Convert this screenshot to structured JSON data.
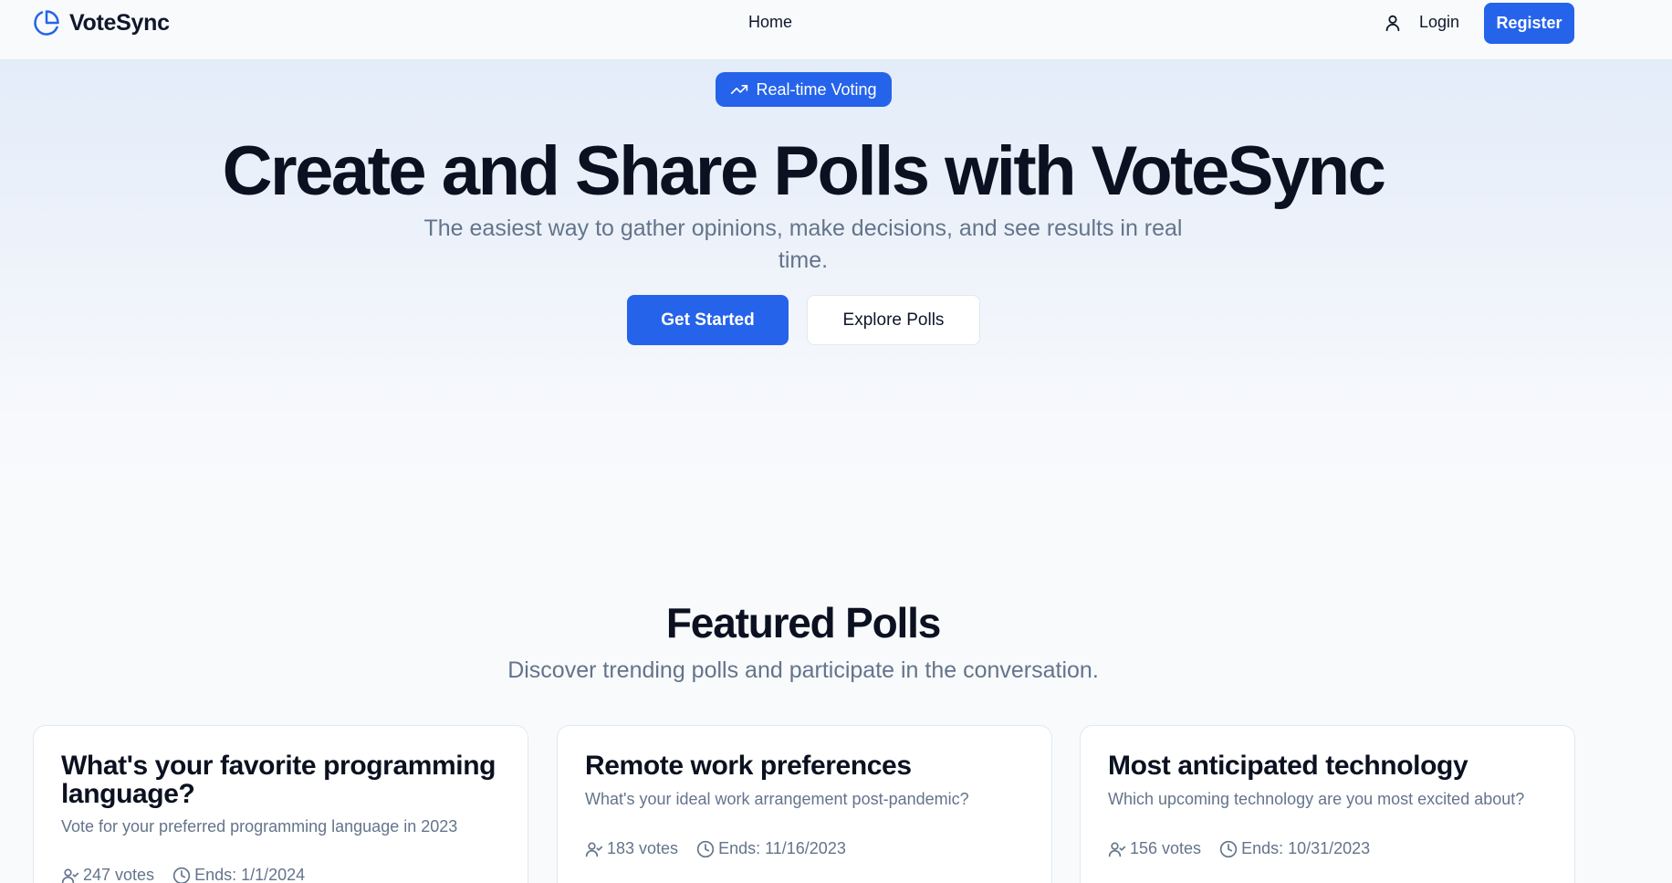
{
  "nav": {
    "brand": "VoteSync",
    "home": "Home",
    "login": "Login",
    "register": "Register"
  },
  "hero": {
    "badge": "Real-time Voting",
    "title": "Create and Share Polls with VoteSync",
    "subtitle": "The easiest way to gather opinions, make decisions, and see results in real time.",
    "primary_button": "Get Started",
    "secondary_button": "Explore Polls"
  },
  "featured": {
    "title": "Featured Polls",
    "subtitle": "Discover trending polls and participate in the conversation.",
    "polls": [
      {
        "title": "What's your favorite programming language?",
        "description": "Vote for your preferred programming language in 2023",
        "votes": "247 votes",
        "ends": "Ends: 1/1/2024"
      },
      {
        "title": "Remote work preferences",
        "description": "What's your ideal work arrangement post-pandemic?",
        "votes": "183 votes",
        "ends": "Ends: 11/16/2023"
      },
      {
        "title": "Most anticipated technology",
        "description": "Which upcoming technology are you most excited about?",
        "votes": "156 votes",
        "ends": "Ends: 10/31/2023"
      }
    ]
  },
  "colors": {
    "accent": "#2563eb",
    "text": "#0f172a",
    "muted": "#64748b"
  },
  "icons": {
    "brand": "pie-chart-icon",
    "user": "user-icon",
    "badge": "trending-up-icon",
    "votes": "users-icon",
    "ends": "clock-icon"
  }
}
